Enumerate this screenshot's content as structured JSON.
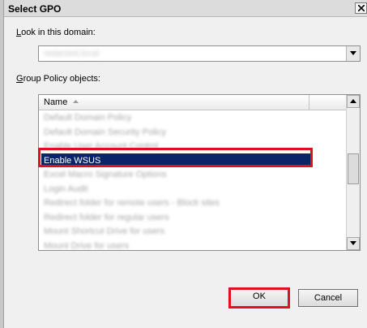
{
  "window": {
    "title": "Select GPO"
  },
  "domain": {
    "label": "Look in this domain:",
    "value": "redacted.local"
  },
  "gpo_list": {
    "label": "Group Policy objects:",
    "columns": [
      "Name"
    ],
    "rows": [
      {
        "name": "Default Domain Policy",
        "blurred": true
      },
      {
        "name": "Default Domain Security Policy",
        "blurred": true
      },
      {
        "name": "Enable User Account Control",
        "blurred": true
      },
      {
        "name": "Enable WSUS",
        "blurred": false,
        "selected": true
      },
      {
        "name": "Excel Macro Signature Options",
        "blurred": true
      },
      {
        "name": "Login Audit",
        "blurred": true
      },
      {
        "name": "Redirect folder for remote users - Block sites",
        "blurred": true
      },
      {
        "name": "Redirect folder for regular users",
        "blurred": true
      },
      {
        "name": "Mount Shortcut Drive for users",
        "blurred": true
      },
      {
        "name": "Mount Drive for users",
        "blurred": true
      }
    ],
    "scroll_position": 0.45
  },
  "buttons": {
    "ok": "OK",
    "cancel": "Cancel"
  }
}
